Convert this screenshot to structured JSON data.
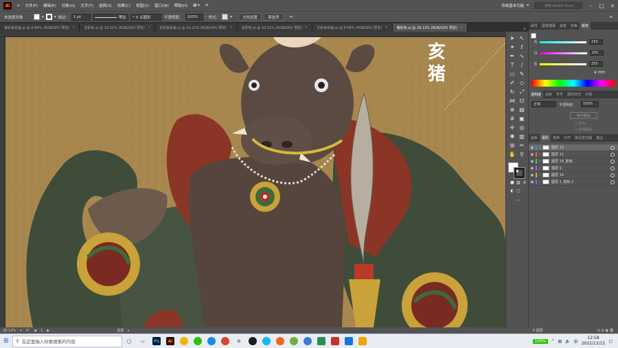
{
  "app": {
    "logo": "Ai"
  },
  "menu": [
    "文件(F)",
    "编辑(E)",
    "对象(O)",
    "文字(T)",
    "选择(S)",
    "效果(C)",
    "视图(V)",
    "窗口(W)",
    "帮助(H)"
  ],
  "workspace": "传统基本功能",
  "search_placeholder": "搜索 Adobe Stock",
  "control": {
    "no_selection": "未选择对象",
    "stroke_label": "描边：",
    "stroke_value": "1 pt",
    "brush_label": "等比",
    "points_label": "5 点圆形",
    "opacity_label": "不透明度：",
    "opacity_value": "100%",
    "style_label": "样式：",
    "doc_setup": "文档设置",
    "preferences": "首选项"
  },
  "tabs": [
    {
      "label": "猴彩色年画.ai @ 8.68% (RGB/GPU 预览)"
    },
    {
      "label": "龙彩色.ai @ 10.21% (RGB/GPU 预览)"
    },
    {
      "label": "龙彩色年画.ai @ 10.21% (RGB/GPU 预览)"
    },
    {
      "label": "龙彩色.ai @ 10.21% (RGB/GPU 预览)"
    },
    {
      "label": "羊彩色年画.ai @ 8.68% (RGB/GPU 预览)"
    },
    {
      "label": "猪彩色.ai @ 28.12% (RGB/GPU 预览)",
      "active": true
    }
  ],
  "artwork": {
    "title_line1": "亥",
    "title_line2": "猪"
  },
  "color_panel": {
    "tabs": [
      "属性",
      "图像描摹",
      "画笔",
      "色板",
      "颜色"
    ],
    "channels": [
      {
        "name": "R",
        "value": "255",
        "gradient": "linear-gradient(90deg,#00ffff,#ffffff)"
      },
      {
        "name": "G",
        "value": "255",
        "gradient": "linear-gradient(90deg,#ff00ff,#ffffff)"
      },
      {
        "name": "B",
        "value": "255",
        "gradient": "linear-gradient(90deg,#ffff00,#ffffff)"
      }
    ],
    "hex": "ffffff"
  },
  "transparency_panel": {
    "tabs": [
      "透明度",
      "渐变",
      "符号",
      "图形样式",
      "外观"
    ],
    "mode": "正常",
    "opacity_label": "不透明度：",
    "opacity_value": "100%",
    "btn_mask": "制作蒙版",
    "clip": "剪切",
    "invert": "反相蒙版"
  },
  "layers_panel": {
    "tabs": [
      "画板",
      "图层",
      "变换",
      "对齐",
      "路径查找器",
      "描边"
    ],
    "layers": [
      {
        "name": "图层 13",
        "color": "#4f7cff",
        "active": true
      },
      {
        "name": "图层 12",
        "color": "#ff4f4f"
      },
      {
        "name": "图层 14_复制",
        "color": "#2ecc71"
      },
      {
        "name": "图层 9",
        "color": "#b44fff"
      },
      {
        "name": "图层 14",
        "color": "#ff9f2e"
      },
      {
        "name": "图层 1_复制 2",
        "color": "#4f7cff"
      }
    ],
    "count": "6 图层"
  },
  "status": {
    "zoom": "28.12%",
    "angle": "0°",
    "artboard": "1",
    "total": "1",
    "mode": "选择"
  },
  "taskbar": {
    "search": "在这里输入你要搜索的内容",
    "battery": "100%",
    "time": "12:58",
    "date": "2022/12/15",
    "lang": "中"
  }
}
